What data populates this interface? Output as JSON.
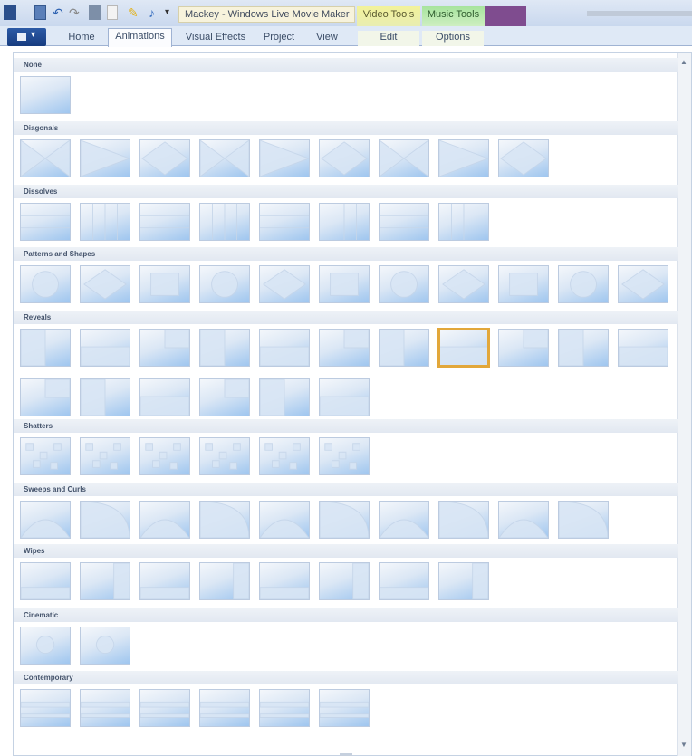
{
  "window": {
    "title": "Mackey - Windows Live Movie Maker",
    "contextual_tabs": [
      "Video Tools",
      "Music Tools"
    ]
  },
  "ribbon": {
    "tabs": [
      {
        "label": "Home"
      },
      {
        "label": "Animations"
      },
      {
        "label": "Visual Effects"
      },
      {
        "label": "Project"
      },
      {
        "label": "View"
      },
      {
        "label": "Edit"
      },
      {
        "label": "Options"
      }
    ],
    "active_tab": "Animations"
  },
  "gallery": {
    "categories": [
      {
        "label": "None",
        "count": 1
      },
      {
        "label": "Diagonals",
        "count": 9
      },
      {
        "label": "Dissolves",
        "count": 8
      },
      {
        "label": "Patterns and Shapes",
        "count": 11
      },
      {
        "label": "Reveals",
        "count": 17
      },
      {
        "label": "Shatters",
        "count": 6
      },
      {
        "label": "Sweeps and Curls",
        "count": 10
      },
      {
        "label": "Wipes",
        "count": 8
      },
      {
        "label": "Cinematic",
        "count": 2
      },
      {
        "label": "Contemporary",
        "count": 6
      }
    ],
    "selected": {
      "category": "Reveals",
      "index": 7
    }
  },
  "colors": {
    "selection_outline": "#e2a73a",
    "tile_blue": "#9fc6ef",
    "header_bg": "#e2e8f1",
    "file_button": "#1f4a92"
  },
  "icons": {
    "app": "app-icon",
    "save": "save-icon",
    "undo": "undo-icon",
    "redo": "redo-icon",
    "film": "film-icon",
    "pen": "pen-icon",
    "music": "music-note-icon",
    "dropdown": "chevron-down-icon",
    "scroll_up": "scroll-up-icon",
    "scroll_down": "scroll-down-icon"
  }
}
